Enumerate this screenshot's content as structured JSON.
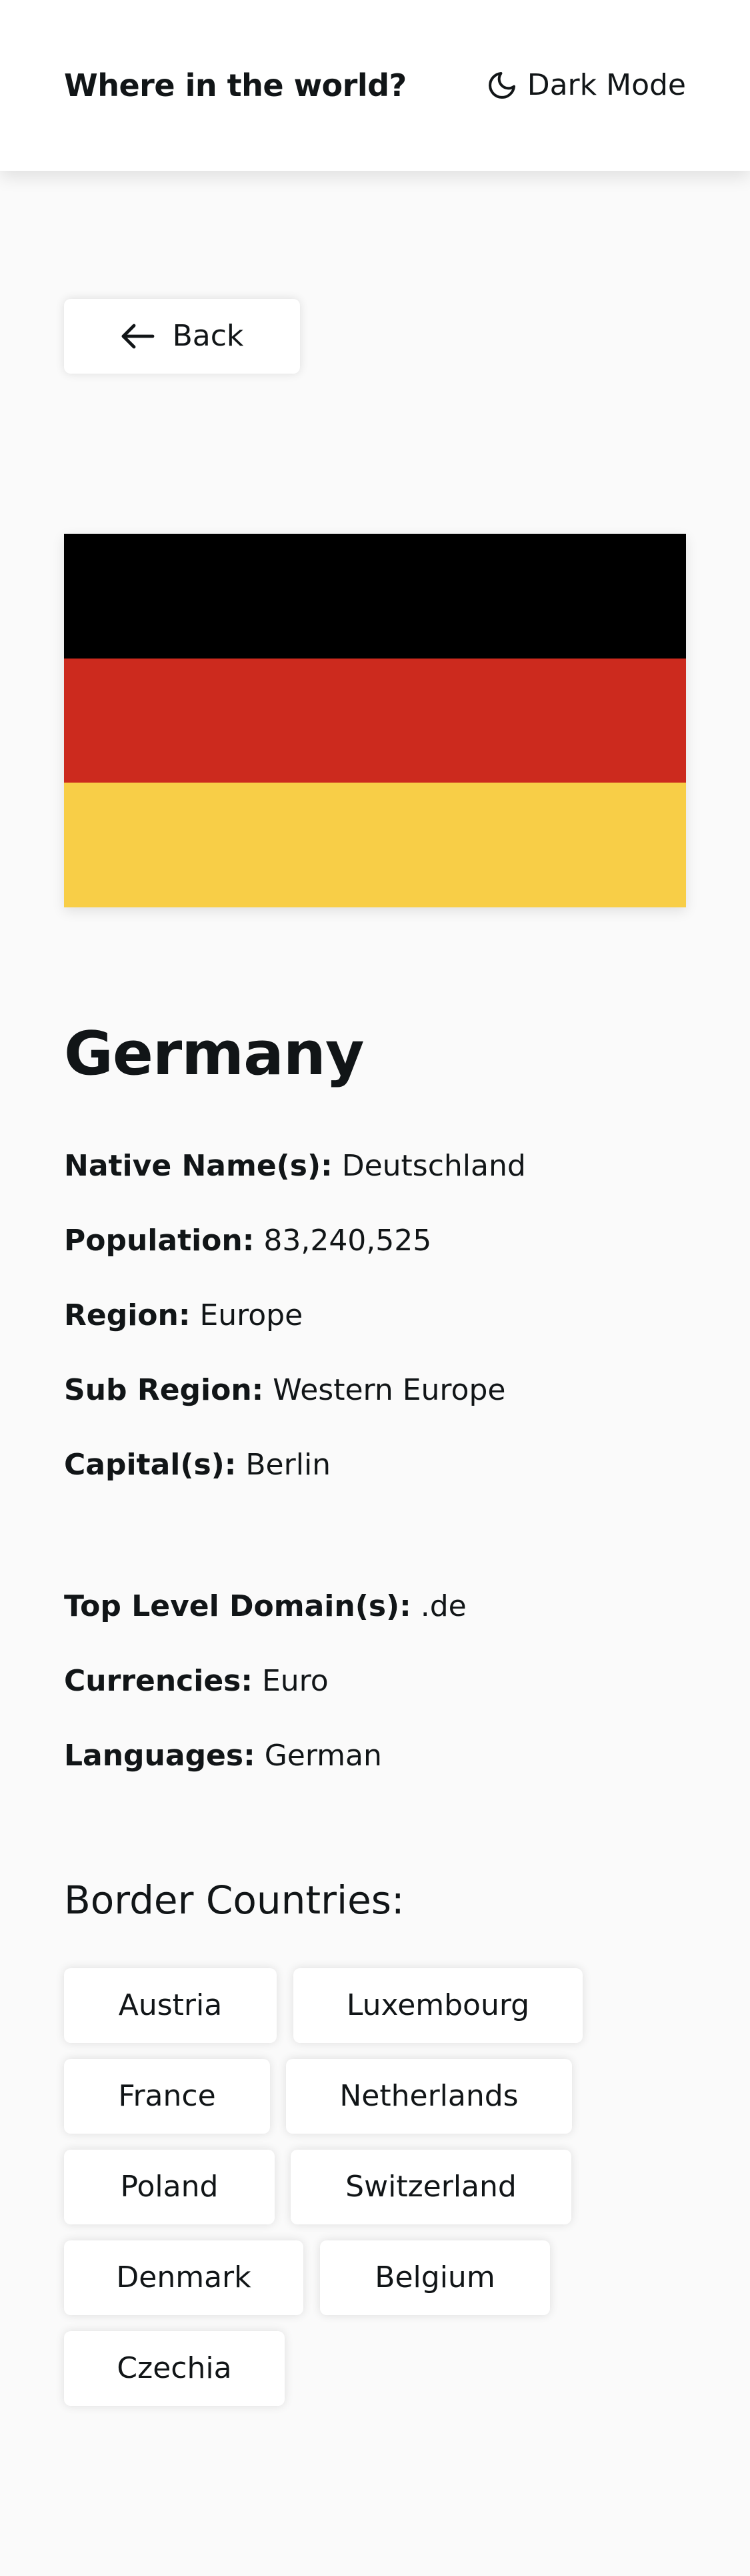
{
  "header": {
    "title": "Where in the world?",
    "theme_toggle_label": "Dark Mode",
    "theme_icon": "moon-icon"
  },
  "back_button": {
    "label": "Back",
    "icon": "arrow-left-icon"
  },
  "country": {
    "name": "Germany",
    "flag": {
      "stripes": [
        "#000000",
        "#cc2a1e",
        "#f8ce47"
      ]
    },
    "details_primary": [
      {
        "key": "Native Name(s):",
        "value": "Deutschland"
      },
      {
        "key": "Population:",
        "value": "83,240,525"
      },
      {
        "key": "Region:",
        "value": "Europe"
      },
      {
        "key": "Sub Region:",
        "value": "Western Europe"
      },
      {
        "key": "Capital(s):",
        "value": "Berlin"
      }
    ],
    "details_secondary": [
      {
        "key": "Top Level Domain(s):",
        "value": ".de"
      },
      {
        "key": "Currencies:",
        "value": "Euro"
      },
      {
        "key": "Languages:",
        "value": "German"
      }
    ],
    "border_title": "Border Countries:",
    "border_countries": [
      "Austria",
      "Luxembourg",
      "France",
      "Netherlands",
      "Poland",
      "Switzerland",
      "Denmark",
      "Belgium",
      "Czechia"
    ]
  },
  "colors": {
    "background": "#fafafa",
    "surface": "#ffffff",
    "text": "#111517"
  }
}
